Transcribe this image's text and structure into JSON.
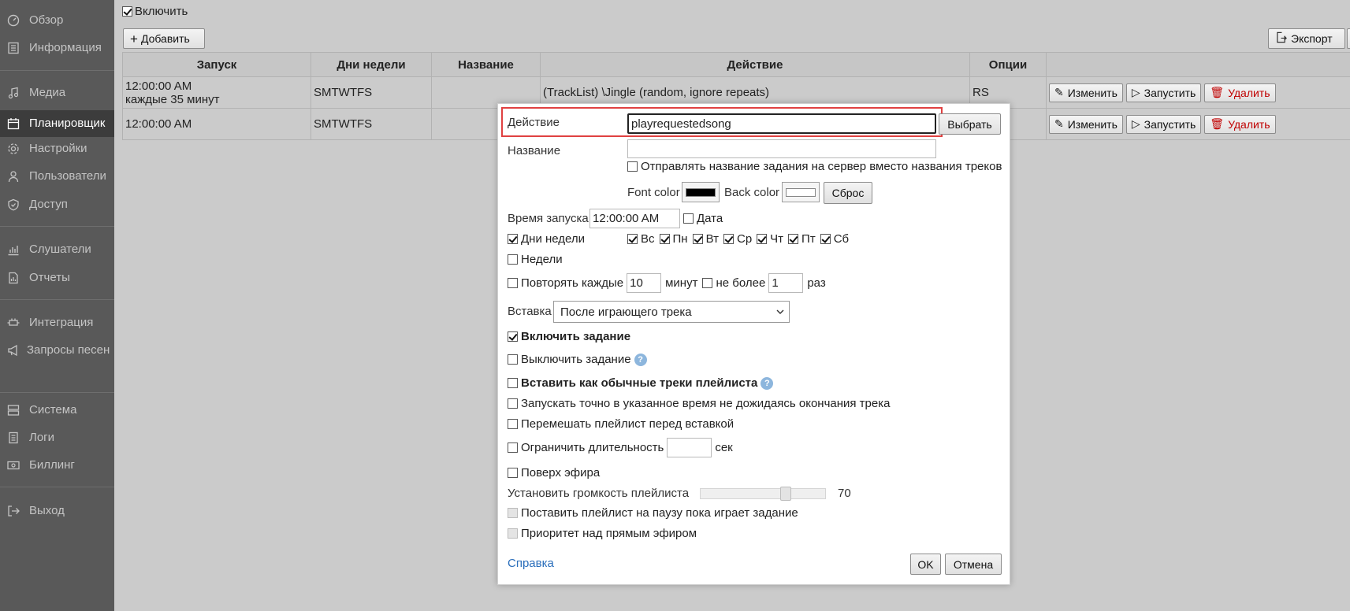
{
  "sidebar": {
    "items": [
      {
        "label": "Обзор",
        "icon": "gauge-icon"
      },
      {
        "label": "Информация",
        "icon": "info-list-icon"
      },
      {
        "label": "Медиа",
        "icon": "music-note-icon"
      },
      {
        "label": "Планировщик",
        "icon": "calendar-icon"
      },
      {
        "label": "Настройки",
        "icon": "gear-icon"
      },
      {
        "label": "Пользователи",
        "icon": "user-icon"
      },
      {
        "label": "Доступ",
        "icon": "shield-icon"
      },
      {
        "label": "Слушатели",
        "icon": "bar-chart-icon"
      },
      {
        "label": "Отчеты",
        "icon": "report-icon"
      },
      {
        "label": "Интеграция",
        "icon": "plug-icon"
      },
      {
        "label": "Запросы песен",
        "icon": "megaphone-icon"
      },
      {
        "label": "Система",
        "icon": "server-icon"
      },
      {
        "label": "Логи",
        "icon": "log-icon"
      },
      {
        "label": "Биллинг",
        "icon": "money-icon"
      },
      {
        "label": "Выход",
        "icon": "logout-icon"
      }
    ],
    "active": "Планировщик"
  },
  "toolbar": {
    "enable_label": "Включить",
    "add_label": "Добавить",
    "export_label": "Экспорт"
  },
  "table": {
    "headers": [
      "Запуск",
      "Дни недели",
      "Название",
      "Действие",
      "Опции",
      ""
    ],
    "rows": [
      {
        "start": "12:00:00 AM",
        "start2": "каждые 35 минут",
        "days": "SMTWTFS",
        "name": "",
        "action": "(TrackList) \\Jingle (random, ignore repeats)",
        "options": "RS"
      },
      {
        "start": "12:00:00 AM",
        "start2": "",
        "days": "SMTWTFS",
        "name": "",
        "action": "",
        "options": ""
      }
    ],
    "edit_label": "Изменить",
    "run_label": "Запустить",
    "delete_label": "Удалить"
  },
  "dialog": {
    "action_label": "Действие",
    "action_value": "playrequestedsong",
    "choose_label": "Выбрать",
    "name_label": "Название",
    "name_value": "",
    "send_name_label": "Отправлять название задания на сервер вместо названия треков",
    "font_color_label": "Font color",
    "font_color": "#000000",
    "back_color_label": "Back color",
    "back_color": "#ffffff",
    "reset_label": "Сброс",
    "start_time_label": "Время запуска",
    "start_time_value": "12:00:00 AM",
    "date_label": "Дата",
    "weekdays_label": "Дни недели",
    "days": [
      "Вс",
      "Пн",
      "Вт",
      "Ср",
      "Чт",
      "Пт",
      "Сб"
    ],
    "weeks_label": "Недели",
    "repeat_label": "Повторять каждые",
    "repeat_value": "10",
    "minutes_label": "минут",
    "no_more_label": "не более",
    "no_more_value": "1",
    "times_label": "раз",
    "insert_label": "Вставка",
    "insert_value": "После играющего трека",
    "enable_task_label": "Включить задание",
    "disable_task_label": "Выключить задание",
    "insert_as_tracks_label": "Вставить как обычные треки плейлиста",
    "run_exact_label": "Запускать точно в указанное время не дожидаясь окончания трека",
    "shuffle_label": "Перемешать плейлист перед вставкой",
    "limit_duration_label": "Ограничить длительность",
    "limit_duration_value": "",
    "sec_label": "сек",
    "over_air_label": "Поверх эфира",
    "volume_label": "Установить громкость плейлиста",
    "volume_value": "70",
    "pause_label": "Поставить плейлист на паузу пока играет задание",
    "priority_label": "Приоритет над прямым эфиром",
    "help_link": "Справка",
    "ok_label": "OK",
    "cancel_label": "Отмена"
  }
}
